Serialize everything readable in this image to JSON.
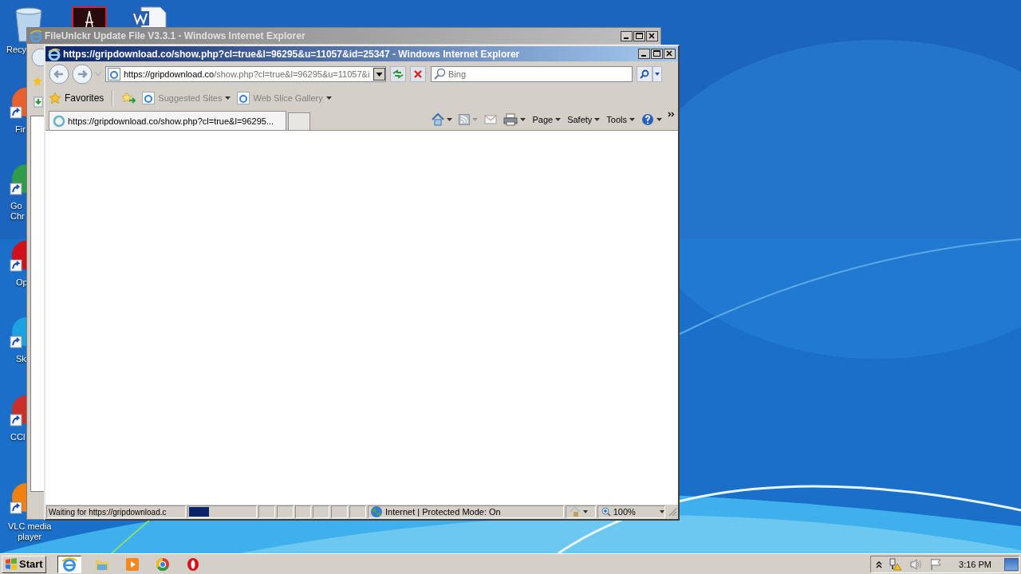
{
  "desktop": {
    "icons": [
      {
        "kind": "recycle",
        "label": "Recy"
      },
      {
        "kind": "acrobat"
      },
      {
        "kind": "word"
      },
      {
        "kind": "firefox",
        "label": "Fir"
      },
      {
        "kind": "chrome",
        "label": "Go\nChr"
      },
      {
        "kind": "opera",
        "label": "Op"
      },
      {
        "kind": "skype",
        "label": "Sk"
      },
      {
        "kind": "ccleaner",
        "label": "CCl"
      },
      {
        "kind": "vlc",
        "label": "VLC media\nplayer"
      }
    ]
  },
  "back_window": {
    "title": "FileUnlckr Update File V3.3.1 - Windows Internet Explorer"
  },
  "window": {
    "title": "https://gripdownload.co/show.php?cl=true&l=96295&u=11057&id=25347 - Windows Internet Explorer",
    "address": {
      "host": "https://gripdownload.co",
      "path": "/show.php?cl=true&l=96295&u=11057&i"
    },
    "search": {
      "placeholder": "Bing"
    },
    "favorites_bar": {
      "favorites": "Favorites",
      "links": [
        "Suggested Sites",
        "Web Slice Gallery"
      ]
    },
    "tabs": [
      {
        "label": "https://gripdownload.co/show.php?cl=true&l=96295...",
        "selected": true
      }
    ],
    "command_bar": [
      "Page",
      "Safety",
      "Tools"
    ],
    "status_bar": {
      "text": "Waiting for https://gripdownload.c",
      "progress": {
        "level": 0.3
      },
      "zone": "Internet | Protected Mode: On",
      "zoom": "100%"
    }
  },
  "taskbar": {
    "start": "Start",
    "apps": [
      {
        "kind": "ie",
        "selected": true
      },
      {
        "kind": "folder",
        "selected": false
      },
      {
        "kind": "media",
        "selected": false
      },
      {
        "kind": "chrome",
        "selected": false
      },
      {
        "kind": "opera",
        "selected": false
      }
    ],
    "clock": "3:16 PM"
  }
}
